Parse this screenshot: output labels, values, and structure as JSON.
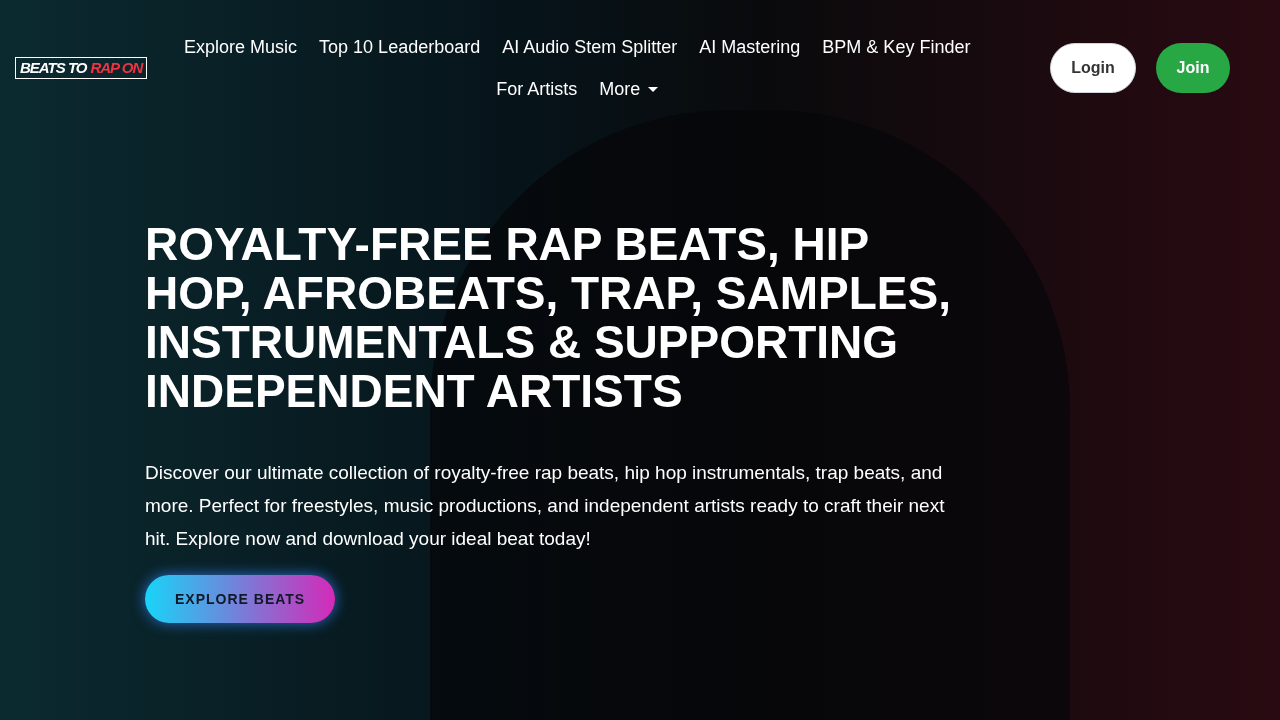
{
  "logo": {
    "part_1": "BEATS TO",
    "part_2": "RAP ON"
  },
  "nav": [
    {
      "label": "Explore Music",
      "kind": "link"
    },
    {
      "label": "Top 10 Leaderboard",
      "kind": "link"
    },
    {
      "label": "AI Audio Stem Splitter",
      "kind": "link"
    },
    {
      "label": "AI Mastering",
      "kind": "link"
    },
    {
      "label": "BPM & Key Finder",
      "kind": "link"
    },
    {
      "label": "For Artists",
      "kind": "link"
    },
    {
      "label": "More",
      "kind": "dropdown"
    }
  ],
  "auth_buttons": [
    {
      "label": "Login",
      "kind": "outline"
    },
    {
      "label": "Join",
      "kind": "primary"
    }
  ],
  "hero": {
    "title": "ROYALTY-FREE RAP BEATS, HIP HOP, AFROBEATS, TRAP, SAMPLES, INSTRUMENTALS & SUPPORTING INDEPENDENT ARTISTS",
    "description": "Discover our ultimate collection of royalty-free rap beats, hip hop instrumentals, trap beats, and more. Perfect for freestyles, music productions, and independent artists ready to craft their next hit. Explore now and download your ideal beat today!",
    "cta": "EXPLORE BEATS"
  }
}
